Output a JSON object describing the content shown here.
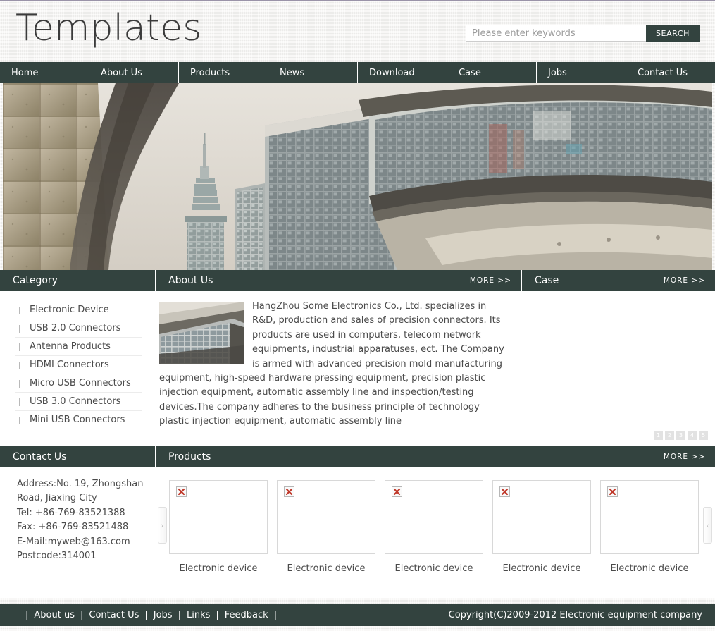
{
  "header": {
    "logo": "Templates",
    "search": {
      "placeholder": "Please enter keywords",
      "value": "",
      "button": "SEARCH"
    }
  },
  "nav": {
    "items": [
      {
        "label": "Home"
      },
      {
        "label": "About Us"
      },
      {
        "label": "Products"
      },
      {
        "label": "News"
      },
      {
        "label": "Download"
      },
      {
        "label": "Case"
      },
      {
        "label": "Jobs"
      },
      {
        "label": "Contact Us"
      }
    ]
  },
  "banner": {
    "alt": "modern office buildings and tower photograph"
  },
  "category": {
    "title": "Category",
    "items": [
      {
        "label": "Electronic Device"
      },
      {
        "label": "USB 2.0 Connectors"
      },
      {
        "label": "Antenna Products"
      },
      {
        "label": "HDMI Connectors"
      },
      {
        "label": "Micro USB Connectors"
      },
      {
        "label": "USB 3.0 Connectors"
      },
      {
        "label": "Mini USB Connectors"
      }
    ]
  },
  "about": {
    "title": "About Us",
    "more": "MORE >>",
    "body": "HangZhou Some Electronics Co., Ltd. specializes in R&D, production and sales of precision connectors. Its products are used in computers, telecom network equipments, industrial apparatuses, ect. The Company is armed with advanced precision mold manufacturing equipment, high-speed hardware pressing equipment, precision plastic injection equipment, automatic assembly line and inspection/testing devices.The company adheres to the business principle of technology plastic injection equipment, automatic assembly line"
  },
  "case": {
    "title": "Case",
    "more": "MORE >>",
    "pages": [
      "1",
      "2",
      "3",
      "4",
      "5"
    ]
  },
  "contact": {
    "title": "Contact Us",
    "lines": [
      "Address:No. 19, Zhongshan",
      "Road, Jiaxing City",
      "Tel: +86-769-83521388",
      "Fax: +86-769-83521488",
      "E-Mail:myweb@163.com",
      "Postcode:314001"
    ]
  },
  "products": {
    "title": "Products",
    "more": "MORE >>",
    "prev_arrow": "›",
    "next_arrow": "‹",
    "items": [
      {
        "label": "Electronic device",
        "image": "broken-image"
      },
      {
        "label": "Electronic device",
        "image": "broken-image"
      },
      {
        "label": "Electronic device",
        "image": "broken-image"
      },
      {
        "label": "Electronic device",
        "image": "broken-image"
      },
      {
        "label": "Electronic device",
        "image": "broken-image"
      }
    ]
  },
  "footer": {
    "links": [
      {
        "label": "About us"
      },
      {
        "label": "Contact Us"
      },
      {
        "label": "Jobs"
      },
      {
        "label": "Links"
      },
      {
        "label": "Feedback"
      }
    ],
    "separator": "|",
    "copyright": "Copyright(C)2009-2012 Electronic equipment company"
  },
  "colors": {
    "dark": "#33433f",
    "page_bg": "#f2f1ef",
    "panel_bg": "#ffffff",
    "top_rule": "#9a93a8",
    "broken_x": "#c0392b"
  }
}
